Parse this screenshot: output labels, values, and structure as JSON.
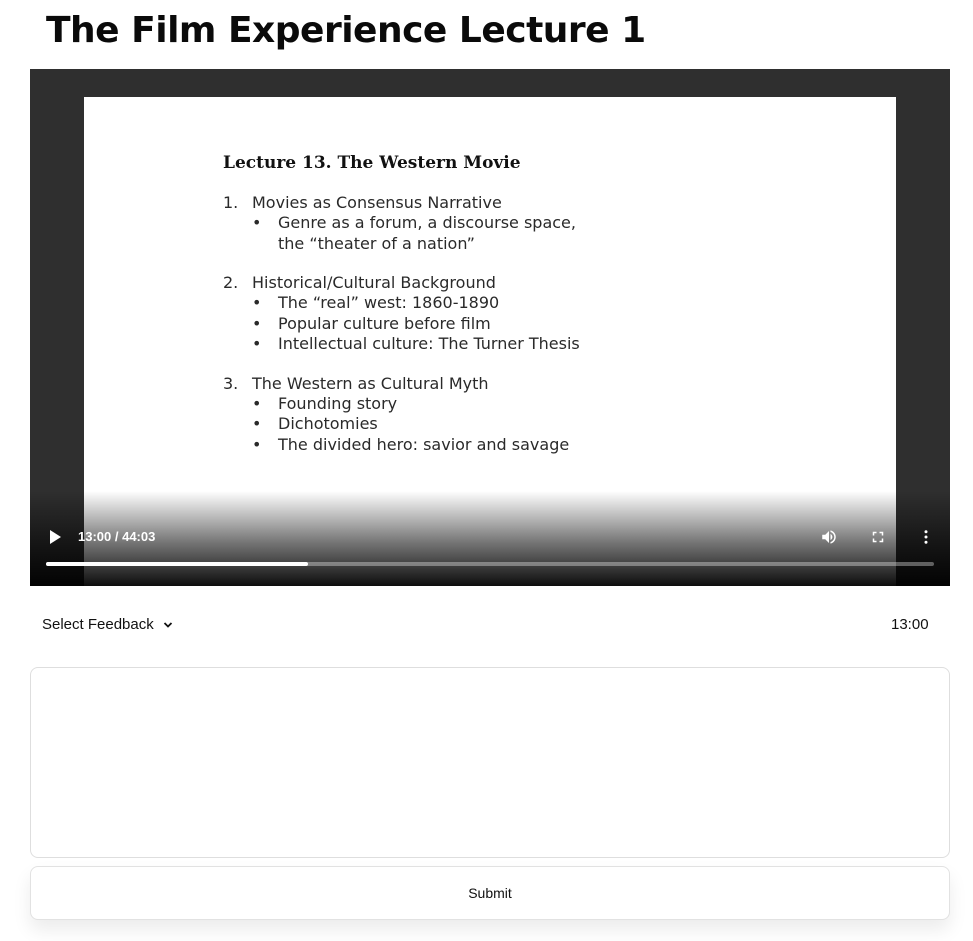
{
  "page": {
    "title": "The Film Experience Lecture 1"
  },
  "slide": {
    "heading": "Lecture 13. The Western Movie",
    "sections": [
      {
        "number": "1.",
        "title": "Movies as Consensus Narrative",
        "bullets": [
          "Genre as a forum, a discourse space,",
          "the “theater of a nation”"
        ]
      },
      {
        "number": "2.",
        "title": "Historical/Cultural  Background",
        "bullets": [
          "The “real” west:  1860-1890",
          "Popular culture before film",
          "Intellectual culture: The Turner Thesis"
        ]
      },
      {
        "number": "3.",
        "title": "The Western as Cultural Myth",
        "bullets": [
          "Founding story",
          "Dichotomies",
          "The divided hero: savior and savage"
        ]
      }
    ]
  },
  "video": {
    "time_display": "13:00 / 44:03",
    "progress_fraction": 0.295,
    "icons": {
      "play": "play-icon",
      "volume": "volume-icon",
      "fullscreen": "fullscreen-icon",
      "more": "more-vert-icon"
    }
  },
  "feedback": {
    "select_label": "Select Feedback",
    "timestamp": "13:00",
    "textarea_value": "",
    "submit_label": "Submit"
  }
}
